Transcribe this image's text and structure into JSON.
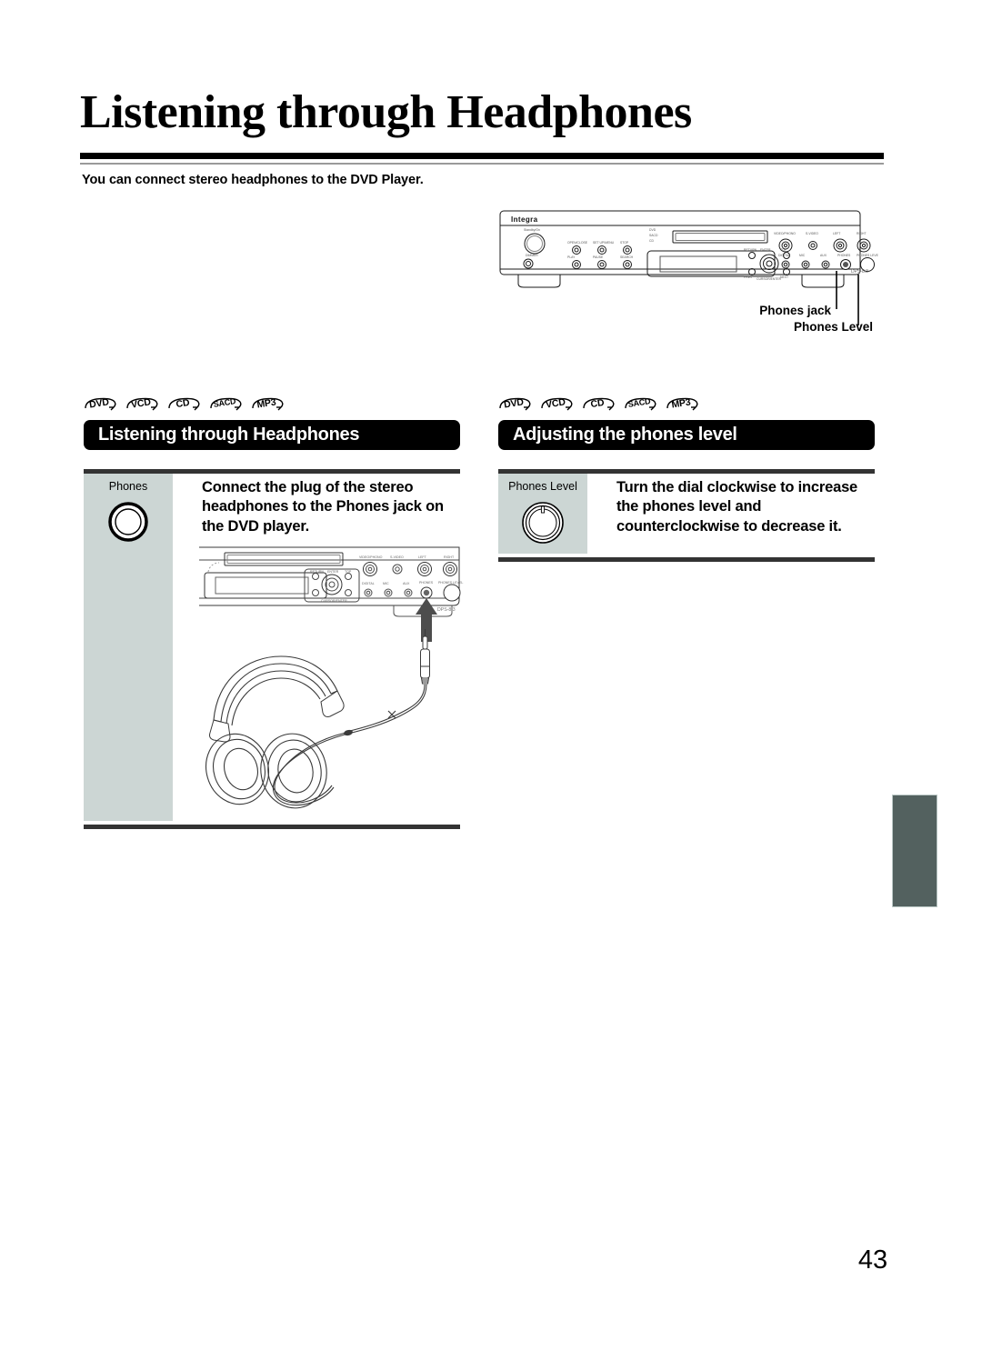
{
  "page": {
    "title": "Listening through Headphones",
    "intro": "You can connect stereo headphones to the DVD Player.",
    "number": "43",
    "brand": "Integra",
    "model": "DPS-8.3",
    "accent_black": "#000000",
    "panel_gray": "#ccd6d4",
    "rule_gray": "#333333",
    "side_tab_color": "#53615f"
  },
  "top_diagram": {
    "callouts": [
      {
        "label": "Phones jack"
      },
      {
        "label": "Phones Level"
      }
    ]
  },
  "formats": [
    {
      "label": "DVD"
    },
    {
      "label": "VCD"
    },
    {
      "label": "CD"
    },
    {
      "label": "SACD"
    },
    {
      "label": "MP3"
    }
  ],
  "sections": [
    {
      "heading": "Listening through Headphones",
      "control_label": "Phones",
      "instruction": "Connect the plug of the stereo headphones to the Phones jack on the DVD player."
    },
    {
      "heading": "Adjusting the phones level",
      "control_label": "Phones Level",
      "instruction": "Turn the dial clockwise to increase the phones level and counterclockwise to decrease it."
    }
  ]
}
